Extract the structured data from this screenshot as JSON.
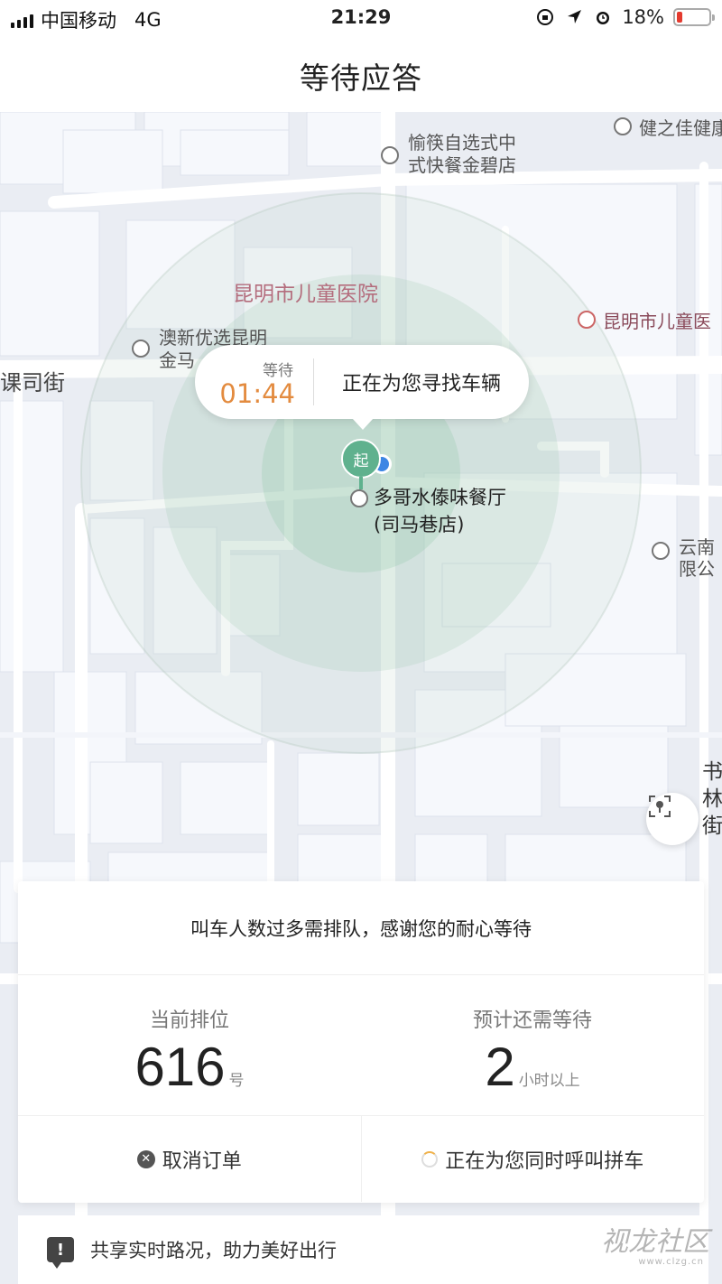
{
  "status_bar": {
    "carrier": "中国移动",
    "network": "4G",
    "time": "21:29",
    "battery": "18%",
    "battery_level": 0.18,
    "battery_color": "#e43b2f"
  },
  "nav": {
    "title": "等待应答"
  },
  "map": {
    "labels": {
      "restaurant1": "愉筷自选式中\n式快餐金碧店",
      "jianzhijia": "健之佳健康",
      "hospital_area": "昆明市儿童医院",
      "hospital_poi": "昆明市儿童医",
      "aoxin": "澳新优选昆明\n金马",
      "kesi_street": "课司街",
      "yunnan": "云南",
      "xiangong": "限公",
      "shulin": "书\n林\n街"
    },
    "poi": "多哥水傣味餐厅\n(司马巷店)",
    "start_marker": "起",
    "icons": [
      "restaurant-icon",
      "bank-icon",
      "hospital-icon",
      "shop-icon",
      "locate-icon"
    ]
  },
  "bubble": {
    "wait_label": "等待",
    "wait_time": "01:44",
    "status": "正在为您寻找车辆",
    "accent_color": "#e38b3f"
  },
  "card": {
    "notice": "叫车人数过多需排队，感谢您的耐心等待",
    "position_label": "当前排位",
    "position_value": "616",
    "position_unit": "号",
    "wait_label": "预计还需等待",
    "wait_value": "2",
    "wait_unit": "小时以上",
    "cancel_label": "取消订单",
    "carpool_label": "正在为您同时呼叫拼车"
  },
  "bottom_bar": {
    "label": "共享实时路况，助力美好出行"
  },
  "watermark": {
    "text": "视龙社区",
    "url": "www.clzg.cn"
  }
}
